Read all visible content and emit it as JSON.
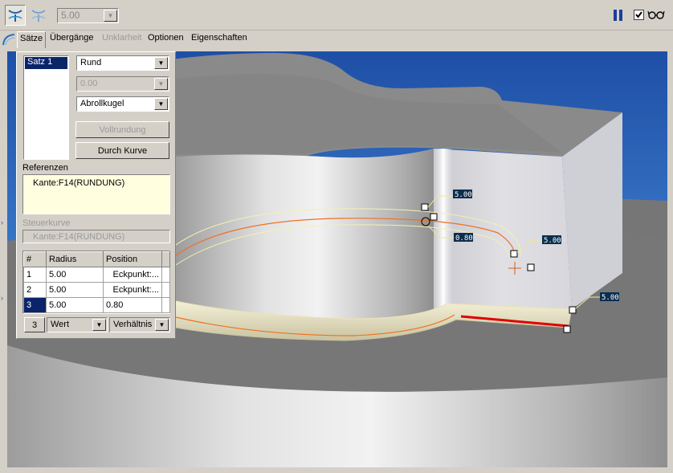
{
  "toolbar": {
    "radius_value": "5.00",
    "icons": [
      "set-mode-icon",
      "transition-mode-icon",
      "pause-icon",
      "checkbox-checked-icon",
      "glasses-icon"
    ]
  },
  "tabs": [
    {
      "label": "Sätze",
      "selected": true,
      "enabled": true
    },
    {
      "label": "Übergänge",
      "selected": false,
      "enabled": true
    },
    {
      "label": "Unklarheit",
      "selected": false,
      "enabled": false
    },
    {
      "label": "Optionen",
      "selected": false,
      "enabled": true
    },
    {
      "label": "Eigenschaften",
      "selected": false,
      "enabled": true
    }
  ],
  "panel": {
    "sets": [
      "Satz 1"
    ],
    "shape_select": "Rund",
    "value_select": "0.00",
    "method_select": "Abrollkugel",
    "full_round_button": "Vollrundung",
    "through_curve_button": "Durch Kurve",
    "references_label": "Referenzen",
    "references": [
      "Kante:F14(RUNDUNG)"
    ],
    "guide_curve_label": "Steuerkurve",
    "guide_curve_value": "Kante:F14(RUNDUNG)",
    "table": {
      "headers": [
        "#",
        "Radius",
        "Position"
      ],
      "rows": [
        {
          "num": "1",
          "radius": "5.00",
          "position": "Eckpunkt:..."
        },
        {
          "num": "2",
          "radius": "5.00",
          "position": "Eckpunkt:..."
        },
        {
          "num": "3",
          "radius": "5.00",
          "position": "0.80"
        }
      ]
    },
    "footer": {
      "count": "3",
      "mode_select": "Wert",
      "ratio_select": "Verhältnis"
    }
  },
  "viewport": {
    "dimension_labels": [
      "5.00",
      "0.80",
      "5.00",
      "5.00"
    ],
    "colors": {
      "background": "#2e63b8",
      "edge_highlight": "#e00000",
      "curve": "#f07020",
      "tag": "#0b2e4e"
    }
  }
}
